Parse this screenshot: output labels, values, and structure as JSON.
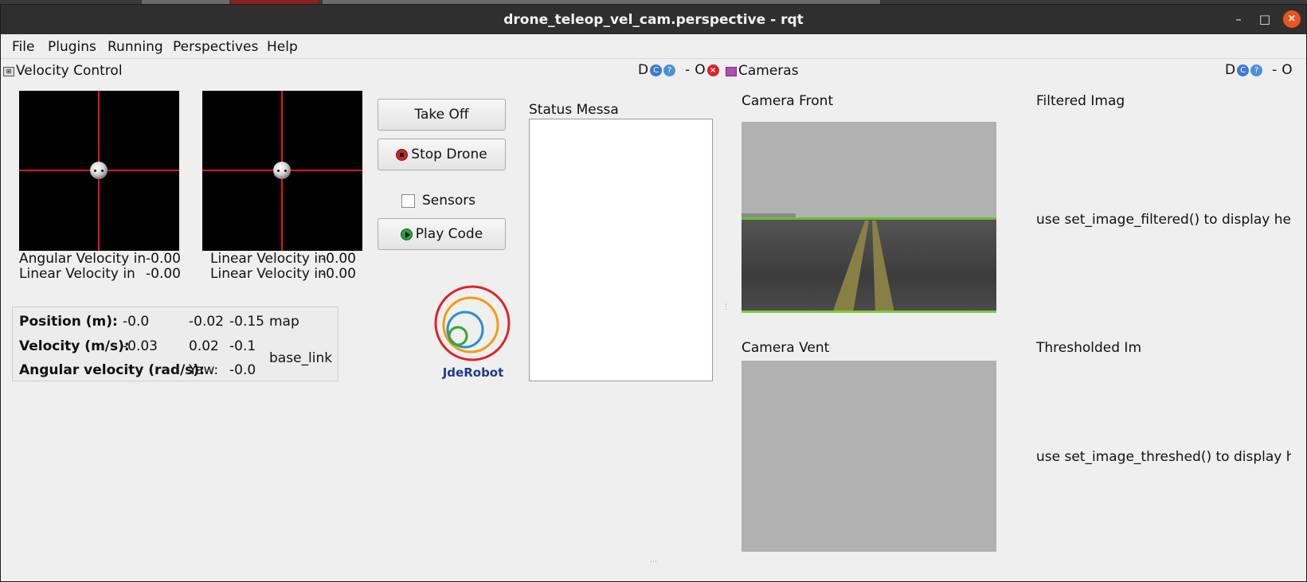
{
  "window": {
    "title": "drone_teleop_vel_cam.perspective - rqt",
    "minimize": "–",
    "maximize": "□",
    "close": "×"
  },
  "menu": [
    "File",
    "Plugins",
    "Running",
    "Perspectives",
    "Help"
  ],
  "velocity_panel": {
    "title": "Velocity Control",
    "dock_controls": {
      "d": "D",
      "c": "C",
      "q": "?",
      "minus": "-",
      "o": "O",
      "x": "×"
    },
    "left_joystick": {
      "line1_label": "Angular Velocity in",
      "line1_value": "-0.00",
      "line2_label": "Linear Velocity in",
      "line2_value": "-0.00"
    },
    "right_joystick": {
      "line1_label": "Linear Velocity in",
      "line1_value": "-0.00",
      "line2_label": "Linear Velocity in",
      "line2_value": "-0.00"
    },
    "buttons": {
      "take_off": "Take Off",
      "stop_drone": "Stop Drone",
      "sensors": "Sensors",
      "play_code": "Play Code"
    },
    "sensors_checked": false,
    "position": {
      "position_label": "Position (m):",
      "position_values": [
        "-0.0",
        "-0.02",
        "-0.15"
      ],
      "position_frame": "map",
      "velocity_label": "Velocity (m/s):",
      "velocity_values": [
        "-0.03",
        "0.02",
        "-0.1"
      ],
      "angular_label": "Angular velocity (rad/s):",
      "yaw_label": "Yaw:",
      "yaw_value": "-0.0",
      "velocity_frame": "base_link"
    },
    "logo_text": "JdeRobot",
    "status_label": "Status Messages"
  },
  "cameras_panel": {
    "title": "Cameras",
    "dock_controls": {
      "d": "D",
      "c": "C",
      "q": "?",
      "minus": "-",
      "o": "O",
      "x": "×"
    },
    "camera_front_label": "Camera Front",
    "camera_ventral_label": "Camera Ventral",
    "filtered_label": "Filtered Image",
    "filtered_hint": "use set_image_filtered() to display here",
    "thresholded_label": "Thresholded Image",
    "thresholded_hint": "use set_image_threshed() to display here"
  },
  "colors": {
    "crosshair": "#e0161b",
    "title_bar": "#2f2f2f",
    "close_button": "#e95420",
    "logo_red": "#d7262c",
    "logo_orange": "#f39c12",
    "logo_blue": "#2a8fd6",
    "logo_green": "#35a82a",
    "logo_text": "#1f3c8f"
  }
}
